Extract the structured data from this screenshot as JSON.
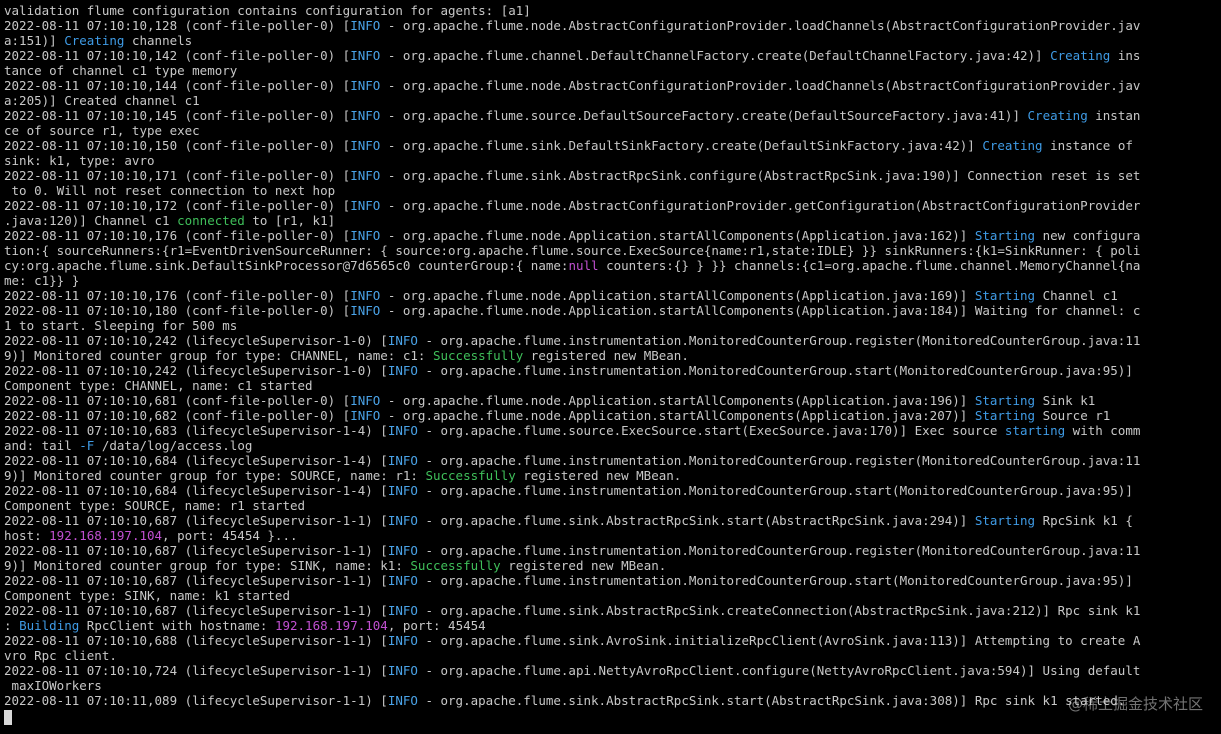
{
  "colors": {
    "text": "#c8c8c8",
    "info": "#4aa3e8",
    "keyword": "#3f9be5",
    "ok": "#3fbf5a",
    "ip": "#c050d0",
    "null": "#c050d0",
    "cursor": "#d9d9d9",
    "background": "#000000"
  },
  "terminal": {
    "lines": [
      [
        {
          "t": "validation flume configuration contains configuration for agents: [a1]"
        }
      ],
      [
        {
          "t": "2022-08-11 07:10:10,128 (conf-file-poller-0) ["
        },
        {
          "t": "INFO",
          "c": "info"
        },
        {
          "t": " - org.apache.flume.node.AbstractConfigurationProvider.loadChannels(AbstractConfigurationProvider.jav"
        }
      ],
      [
        {
          "t": "a:151)] "
        },
        {
          "t": "Creating",
          "c": "keyword"
        },
        {
          "t": " channels"
        }
      ],
      [
        {
          "t": "2022-08-11 07:10:10,142 (conf-file-poller-0) ["
        },
        {
          "t": "INFO",
          "c": "info"
        },
        {
          "t": " - org.apache.flume.channel.DefaultChannelFactory.create(DefaultChannelFactory.java:42)] "
        },
        {
          "t": "Creating",
          "c": "keyword"
        },
        {
          "t": " ins"
        }
      ],
      [
        {
          "t": "tance of channel c1 type memory"
        }
      ],
      [
        {
          "t": "2022-08-11 07:10:10,144 (conf-file-poller-0) ["
        },
        {
          "t": "INFO",
          "c": "info"
        },
        {
          "t": " - org.apache.flume.node.AbstractConfigurationProvider.loadChannels(AbstractConfigurationProvider.jav"
        }
      ],
      [
        {
          "t": "a:205)] Created channel c1"
        }
      ],
      [
        {
          "t": "2022-08-11 07:10:10,145 (conf-file-poller-0) ["
        },
        {
          "t": "INFO",
          "c": "info"
        },
        {
          "t": " - org.apache.flume.source.DefaultSourceFactory.create(DefaultSourceFactory.java:41)] "
        },
        {
          "t": "Creating",
          "c": "keyword"
        },
        {
          "t": " instan"
        }
      ],
      [
        {
          "t": "ce of source r1, type exec"
        }
      ],
      [
        {
          "t": "2022-08-11 07:10:10,150 (conf-file-poller-0) ["
        },
        {
          "t": "INFO",
          "c": "info"
        },
        {
          "t": " - org.apache.flume.sink.DefaultSinkFactory.create(DefaultSinkFactory.java:42)] "
        },
        {
          "t": "Creating",
          "c": "keyword"
        },
        {
          "t": " instance of"
        }
      ],
      [
        {
          "t": "sink: k1, type: avro"
        }
      ],
      [
        {
          "t": "2022-08-11 07:10:10,171 (conf-file-poller-0) ["
        },
        {
          "t": "INFO",
          "c": "info"
        },
        {
          "t": " - org.apache.flume.sink.AbstractRpcSink.configure(AbstractRpcSink.java:190)] Connection reset is set"
        }
      ],
      [
        {
          "t": " to 0. Will not reset connection to next hop"
        }
      ],
      [
        {
          "t": "2022-08-11 07:10:10,172 (conf-file-poller-0) ["
        },
        {
          "t": "INFO",
          "c": "info"
        },
        {
          "t": " - org.apache.flume.node.AbstractConfigurationProvider.getConfiguration(AbstractConfigurationProvider"
        }
      ],
      [
        {
          "t": ".java:120)] Channel c1 "
        },
        {
          "t": "connected",
          "c": "ok"
        },
        {
          "t": " to [r1, k1]"
        }
      ],
      [
        {
          "t": "2022-08-11 07:10:10,176 (conf-file-poller-0) ["
        },
        {
          "t": "INFO",
          "c": "info"
        },
        {
          "t": " - org.apache.flume.node.Application.startAllComponents(Application.java:162)] "
        },
        {
          "t": "Starting",
          "c": "keyword"
        },
        {
          "t": " new configura"
        }
      ],
      [
        {
          "t": "tion:{ sourceRunners:{r1=EventDrivenSourceRunner: { source:org.apache.flume.source.ExecSource{name:r1,state:IDLE} }} sinkRunners:{k1=SinkRunner: { poli"
        }
      ],
      [
        {
          "t": "cy:org.apache.flume.sink.DefaultSinkProcessor@7d6565c0 counterGroup:{ name:"
        },
        {
          "t": "null",
          "c": "null"
        },
        {
          "t": " counters:{} } }} channels:{c1=org.apache.flume.channel.MemoryChannel{na"
        }
      ],
      [
        {
          "t": "me: c1}} }"
        }
      ],
      [
        {
          "t": "2022-08-11 07:10:10,176 (conf-file-poller-0) ["
        },
        {
          "t": "INFO",
          "c": "info"
        },
        {
          "t": " - org.apache.flume.node.Application.startAllComponents(Application.java:169)] "
        },
        {
          "t": "Starting",
          "c": "keyword"
        },
        {
          "t": " Channel c1"
        }
      ],
      [
        {
          "t": "2022-08-11 07:10:10,180 (conf-file-poller-0) ["
        },
        {
          "t": "INFO",
          "c": "info"
        },
        {
          "t": " - org.apache.flume.node.Application.startAllComponents(Application.java:184)] Waiting for channel: c"
        }
      ],
      [
        {
          "t": "1 to start. Sleeping for 500 ms"
        }
      ],
      [
        {
          "t": "2022-08-11 07:10:10,242 (lifecycleSupervisor-1-0) ["
        },
        {
          "t": "INFO",
          "c": "info"
        },
        {
          "t": " - org.apache.flume.instrumentation.MonitoredCounterGroup.register(MonitoredCounterGroup.java:11"
        }
      ],
      [
        {
          "t": "9)] Monitored counter group for type: CHANNEL, name: c1: "
        },
        {
          "t": "Successfully",
          "c": "ok"
        },
        {
          "t": " registered new MBean."
        }
      ],
      [
        {
          "t": "2022-08-11 07:10:10,242 (lifecycleSupervisor-1-0) ["
        },
        {
          "t": "INFO",
          "c": "info"
        },
        {
          "t": " - org.apache.flume.instrumentation.MonitoredCounterGroup.start(MonitoredCounterGroup.java:95)]"
        }
      ],
      [
        {
          "t": "Component type: CHANNEL, name: c1 started"
        }
      ],
      [
        {
          "t": "2022-08-11 07:10:10,681 (conf-file-poller-0) ["
        },
        {
          "t": "INFO",
          "c": "info"
        },
        {
          "t": " - org.apache.flume.node.Application.startAllComponents(Application.java:196)] "
        },
        {
          "t": "Starting",
          "c": "keyword"
        },
        {
          "t": " Sink k1"
        }
      ],
      [
        {
          "t": "2022-08-11 07:10:10,682 (conf-file-poller-0) ["
        },
        {
          "t": "INFO",
          "c": "info"
        },
        {
          "t": " - org.apache.flume.node.Application.startAllComponents(Application.java:207)] "
        },
        {
          "t": "Starting",
          "c": "keyword"
        },
        {
          "t": " Source r1"
        }
      ],
      [
        {
          "t": "2022-08-11 07:10:10,683 (lifecycleSupervisor-1-4) ["
        },
        {
          "t": "INFO",
          "c": "info"
        },
        {
          "t": " - org.apache.flume.source.ExecSource.start(ExecSource.java:170)] Exec source "
        },
        {
          "t": "starting",
          "c": "keyword"
        },
        {
          "t": " with comm"
        }
      ],
      [
        {
          "t": "and: tail "
        },
        {
          "t": "-F",
          "c": "keyword"
        },
        {
          "t": " /data/log/access.log"
        }
      ],
      [
        {
          "t": "2022-08-11 07:10:10,684 (lifecycleSupervisor-1-4) ["
        },
        {
          "t": "INFO",
          "c": "info"
        },
        {
          "t": " - org.apache.flume.instrumentation.MonitoredCounterGroup.register(MonitoredCounterGroup.java:11"
        }
      ],
      [
        {
          "t": "9)] Monitored counter group for type: SOURCE, name: r1: "
        },
        {
          "t": "Successfully",
          "c": "ok"
        },
        {
          "t": " registered new MBean."
        }
      ],
      [
        {
          "t": "2022-08-11 07:10:10,684 (lifecycleSupervisor-1-4) ["
        },
        {
          "t": "INFO",
          "c": "info"
        },
        {
          "t": " - org.apache.flume.instrumentation.MonitoredCounterGroup.start(MonitoredCounterGroup.java:95)]"
        }
      ],
      [
        {
          "t": "Component type: SOURCE, name: r1 started"
        }
      ],
      [
        {
          "t": "2022-08-11 07:10:10,687 (lifecycleSupervisor-1-1) ["
        },
        {
          "t": "INFO",
          "c": "info"
        },
        {
          "t": " - org.apache.flume.sink.AbstractRpcSink.start(AbstractRpcSink.java:294)] "
        },
        {
          "t": "Starting",
          "c": "keyword"
        },
        {
          "t": " RpcSink k1 {"
        }
      ],
      [
        {
          "t": "host: "
        },
        {
          "t": "192.168.197.104",
          "c": "ip"
        },
        {
          "t": ", port: 45454 }..."
        }
      ],
      [
        {
          "t": "2022-08-11 07:10:10,687 (lifecycleSupervisor-1-1) ["
        },
        {
          "t": "INFO",
          "c": "info"
        },
        {
          "t": " - org.apache.flume.instrumentation.MonitoredCounterGroup.register(MonitoredCounterGroup.java:11"
        }
      ],
      [
        {
          "t": "9)] Monitored counter group for type: SINK, name: k1: "
        },
        {
          "t": "Successfully",
          "c": "ok"
        },
        {
          "t": " registered new MBean."
        }
      ],
      [
        {
          "t": "2022-08-11 07:10:10,687 (lifecycleSupervisor-1-1) ["
        },
        {
          "t": "INFO",
          "c": "info"
        },
        {
          "t": " - org.apache.flume.instrumentation.MonitoredCounterGroup.start(MonitoredCounterGroup.java:95)]"
        }
      ],
      [
        {
          "t": "Component type: SINK, name: k1 started"
        }
      ],
      [
        {
          "t": "2022-08-11 07:10:10,687 (lifecycleSupervisor-1-1) ["
        },
        {
          "t": "INFO",
          "c": "info"
        },
        {
          "t": " - org.apache.flume.sink.AbstractRpcSink.createConnection(AbstractRpcSink.java:212)] Rpc sink k1"
        }
      ],
      [
        {
          "t": ": "
        },
        {
          "t": "Building",
          "c": "keyword"
        },
        {
          "t": " RpcClient with hostname: "
        },
        {
          "t": "192.168.197.104",
          "c": "ip"
        },
        {
          "t": ", port: 45454"
        }
      ],
      [
        {
          "t": "2022-08-11 07:10:10,688 (lifecycleSupervisor-1-1) ["
        },
        {
          "t": "INFO",
          "c": "info"
        },
        {
          "t": " - org.apache.flume.sink.AvroSink.initializeRpcClient(AvroSink.java:113)] Attempting to create A"
        }
      ],
      [
        {
          "t": "vro Rpc client."
        }
      ],
      [
        {
          "t": "2022-08-11 07:10:10,724 (lifecycleSupervisor-1-1) ["
        },
        {
          "t": "INFO",
          "c": "info"
        },
        {
          "t": " - org.apache.flume.api.NettyAvroRpcClient.configure(NettyAvroRpcClient.java:594)] Using default"
        }
      ],
      [
        {
          "t": " maxIOWorkers"
        }
      ],
      [
        {
          "t": "2022-08-11 07:10:11,089 (lifecycleSupervisor-1-1) ["
        },
        {
          "t": "INFO",
          "c": "info"
        },
        {
          "t": " - org.apache.flume.sink.AbstractRpcSink.start(AbstractRpcSink.java:308)] Rpc sink k1 started."
        }
      ]
    ]
  },
  "watermark": "@稀土掘金技术社区"
}
